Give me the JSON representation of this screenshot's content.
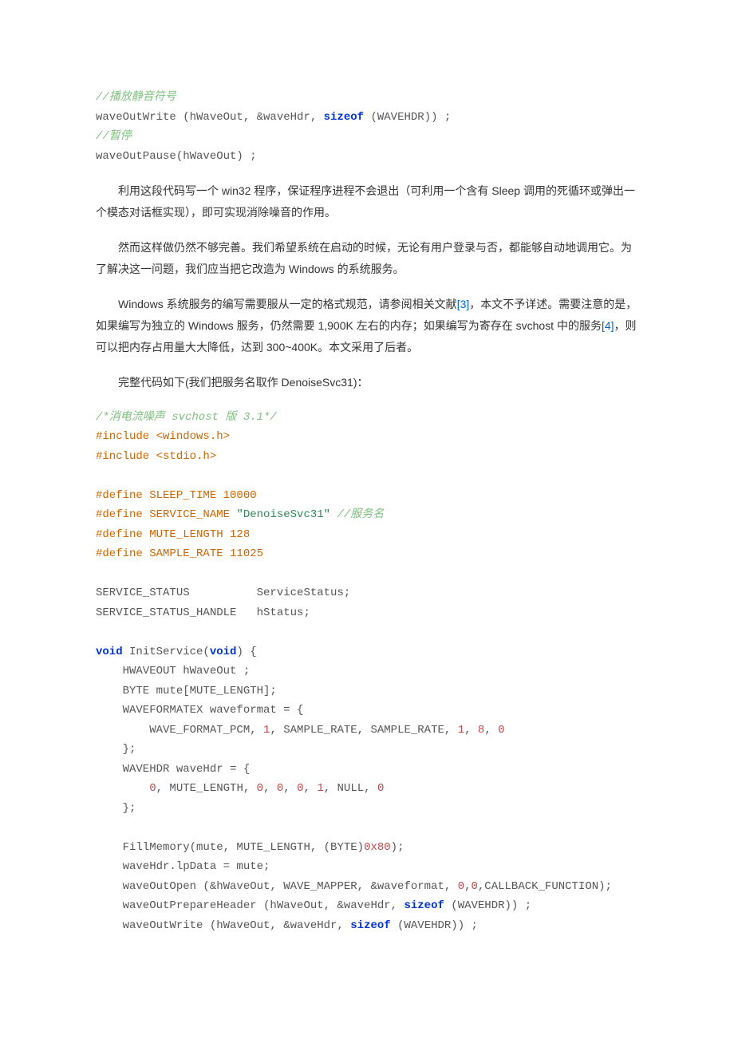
{
  "code1": {
    "c1_comment": "//播放静音符号",
    "c1_line": "waveOutWrite (hWaveOut, &waveHdr, ",
    "c1_kw": "sizeof",
    "c1_tail": " (WAVEHDR)) ;",
    "c2_comment": "//暂停",
    "c2_line": "waveOutPause(hWaveOut) ;"
  },
  "prose": {
    "p1": "利用这段代码写一个 win32 程序，保证程序进程不会退出（可利用一个含有 Sleep 调用的死循环或弹出一个模态对话框实现），即可实现消除噪音的作用。",
    "p2": "然而这样做仍然不够完善。我们希望系统在启动的时候，无论有用户登录与否，都能够自动地调用它。为了解决这一问题，我们应当把它改造为 Windows 的系统服务。",
    "p3a": "Windows 系统服务的编写需要服从一定的格式规范，请参阅相关文献",
    "p3ref1": "[3]",
    "p3b": "，本文不予详述。需要注意的是，如果编写为独立的 Windows 服务，仍然需要 1,900K 左右的内存；如果编写为寄存在 svchost 中的服务",
    "p3ref2": "[4]",
    "p3c": "，则可以把内存占用量大大降低，达到 300~400K。本文采用了后者。",
    "p4": "完整代码如下(我们把服务名取作 DenoiseSvc31)："
  },
  "code2": {
    "hdr_comment": "/*消电流噪声 svchost 版 3.1*/",
    "inc1": "#include <windows.h>",
    "inc2": "#include <stdio.h>",
    "def1": "#define SLEEP_TIME 10000",
    "def2a": "#define SERVICE_NAME ",
    "def2str": "\"DenoiseSvc31\"",
    "def2c": " //服务名",
    "def3": "#define MUTE_LENGTH 128",
    "def4": "#define SAMPLE_RATE 11025",
    "decl1": "SERVICE_STATUS          ServiceStatus;",
    "decl2": "SERVICE_STATUS_HANDLE   hStatus;",
    "fn_void1": "void",
    "fn_name": " InitService(",
    "fn_void2": "void",
    "fn_open": ") {",
    "b1": "    HWAVEOUT hWaveOut ;",
    "b2": "    BYTE mute[MUTE_LENGTH];",
    "b3": "    WAVEFORMATEX waveformat = {",
    "b4a": "        WAVE_FORMAT_PCM, ",
    "b4n1": "1",
    "b4b": ", SAMPLE_RATE, SAMPLE_RATE, ",
    "b4n2": "1",
    "b4c": ", ",
    "b4n3": "8",
    "b4d": ", ",
    "b4n4": "0",
    "b5": "    };",
    "b6": "    WAVEHDR waveHdr = {",
    "b7a": "        ",
    "b7n1": "0",
    "b7b": ", MUTE_LENGTH, ",
    "b7n2": "0",
    "b7c": ", ",
    "b7n3": "0",
    "b7d": ", ",
    "b7n4": "0",
    "b7e": ", ",
    "b7n5": "1",
    "b7f": ", NULL, ",
    "b7n6": "0",
    "b8": "    };",
    "b10a": "    FillMemory(mute, MUTE_LENGTH, (BYTE)",
    "b10hex": "0x80",
    "b10b": ");",
    "b11": "    waveHdr.lpData = mute;",
    "b12a": "    waveOutOpen (&hWaveOut, WAVE_MAPPER, &waveformat, ",
    "b12n1": "0",
    "b12b": ",",
    "b12n2": "0",
    "b12c": ",CALLBACK_FUNCTION);",
    "b13a": "    waveOutPrepareHeader (hWaveOut, &waveHdr, ",
    "b13kw": "sizeof",
    "b13b": " (WAVEHDR)) ;",
    "b14a": "    waveOutWrite (hWaveOut, &waveHdr, ",
    "b14kw": "sizeof",
    "b14b": " (WAVEHDR)) ;"
  }
}
